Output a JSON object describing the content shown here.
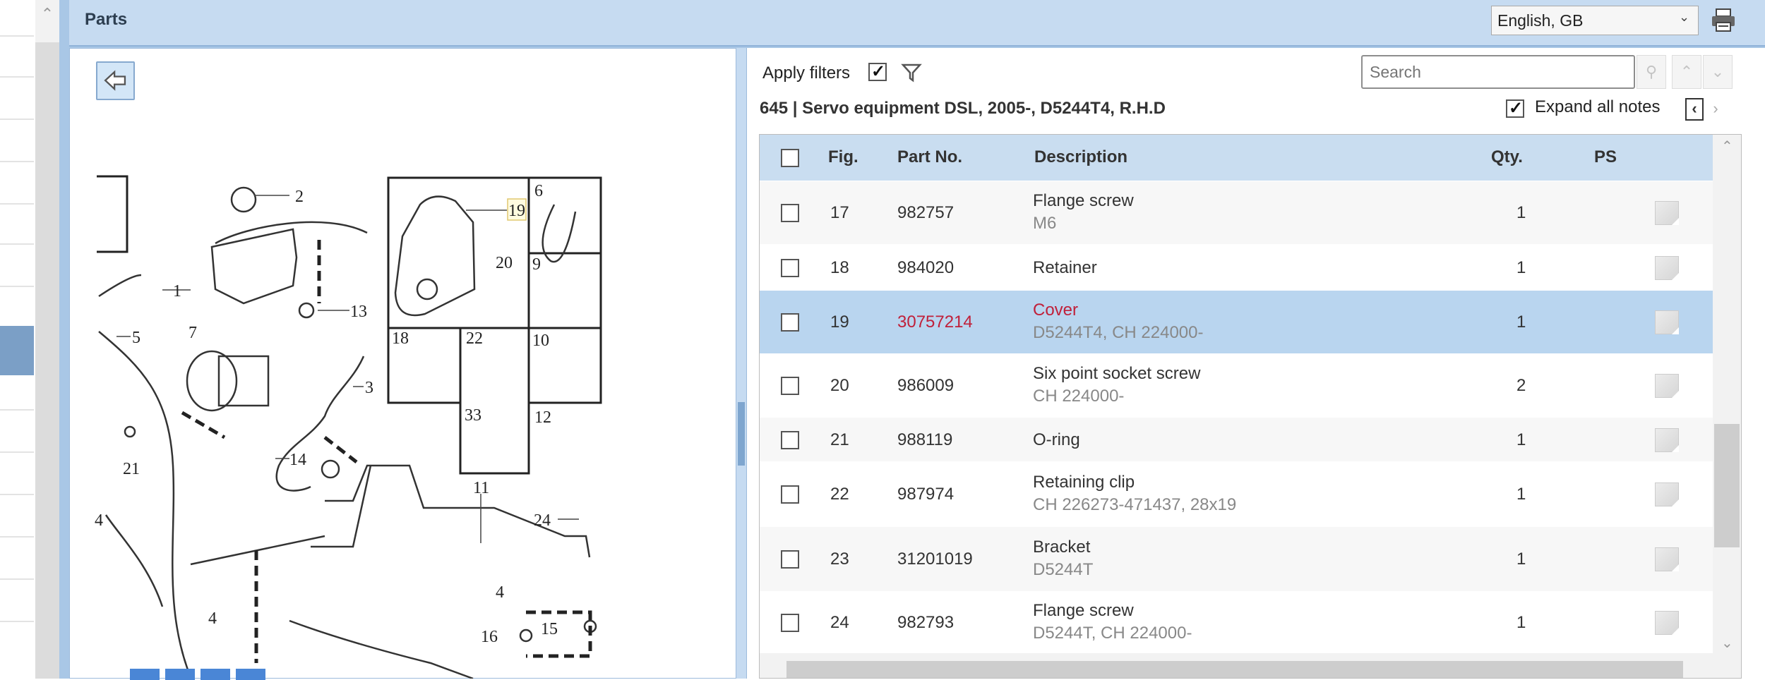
{
  "header": {
    "title": "Parts",
    "language": "English, GB"
  },
  "filters": {
    "apply_label": "Apply filters",
    "apply_checked": true,
    "search_placeholder": "Search"
  },
  "section": {
    "title": "645  |  Servo equipment DSL, 2005-, D5244T4, R.H.D",
    "expand_notes_label": "Expand all notes",
    "expand_notes_checked": true
  },
  "table": {
    "columns": [
      "Fig.",
      "Part No.",
      "Description",
      "Qty.",
      "PS"
    ],
    "rows": [
      {
        "fig": "17",
        "part_no": "982757",
        "description": "Flange screw",
        "note": "M6",
        "qty": "1"
      },
      {
        "fig": "18",
        "part_no": "984020",
        "description": "Retainer",
        "note": "",
        "qty": "1"
      },
      {
        "fig": "19",
        "part_no": "30757214",
        "description": "Cover",
        "note": "D5244T4, CH 224000-",
        "qty": "1",
        "selected": true
      },
      {
        "fig": "20",
        "part_no": "986009",
        "description": "Six point socket screw",
        "note": "CH 224000-",
        "qty": "2"
      },
      {
        "fig": "21",
        "part_no": "988119",
        "description": "O-ring",
        "note": "",
        "qty": "1"
      },
      {
        "fig": "22",
        "part_no": "987974",
        "description": "Retaining clip",
        "note": "CH 226273-471437, 28x19",
        "qty": "1"
      },
      {
        "fig": "23",
        "part_no": "31201019",
        "description": "Bracket",
        "note": "D5244T",
        "qty": "1"
      },
      {
        "fig": "24",
        "part_no": "982793",
        "description": "Flange screw",
        "note": "D5244T, CH 224000-",
        "qty": "1"
      }
    ]
  },
  "diagram": {
    "callouts": [
      "2",
      "19",
      "6",
      "20",
      "9",
      "1",
      "13",
      "5",
      "7",
      "18",
      "22",
      "10",
      "3",
      "33",
      "12",
      "21",
      "14",
      "11",
      "24",
      "4",
      "4",
      "4",
      "16",
      "15"
    ]
  },
  "colors": {
    "header_bg": "#c6dbf1",
    "selected_row": "#b9d5ef",
    "highlight_part": "#c0203a"
  }
}
